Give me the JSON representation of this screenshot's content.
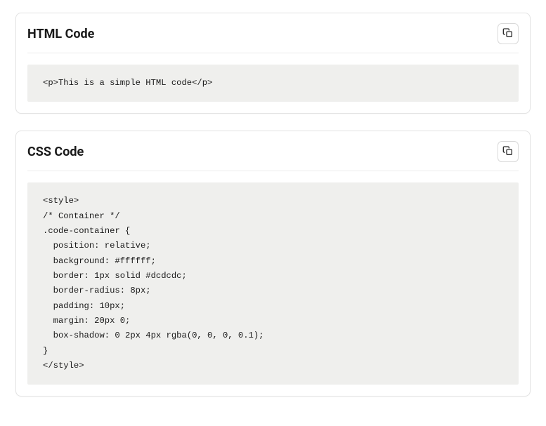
{
  "cards": [
    {
      "title": "HTML Code",
      "code": "<p>This is a simple HTML code</p>"
    },
    {
      "title": "CSS Code",
      "code": "<style>\n/* Container */\n.code-container {\n  position: relative;\n  background: #ffffff;\n  border: 1px solid #dcdcdc;\n  border-radius: 8px;\n  padding: 10px;\n  margin: 20px 0;\n  box-shadow: 0 2px 4px rgba(0, 0, 0, 0.1);\n}\n</style>"
    }
  ]
}
